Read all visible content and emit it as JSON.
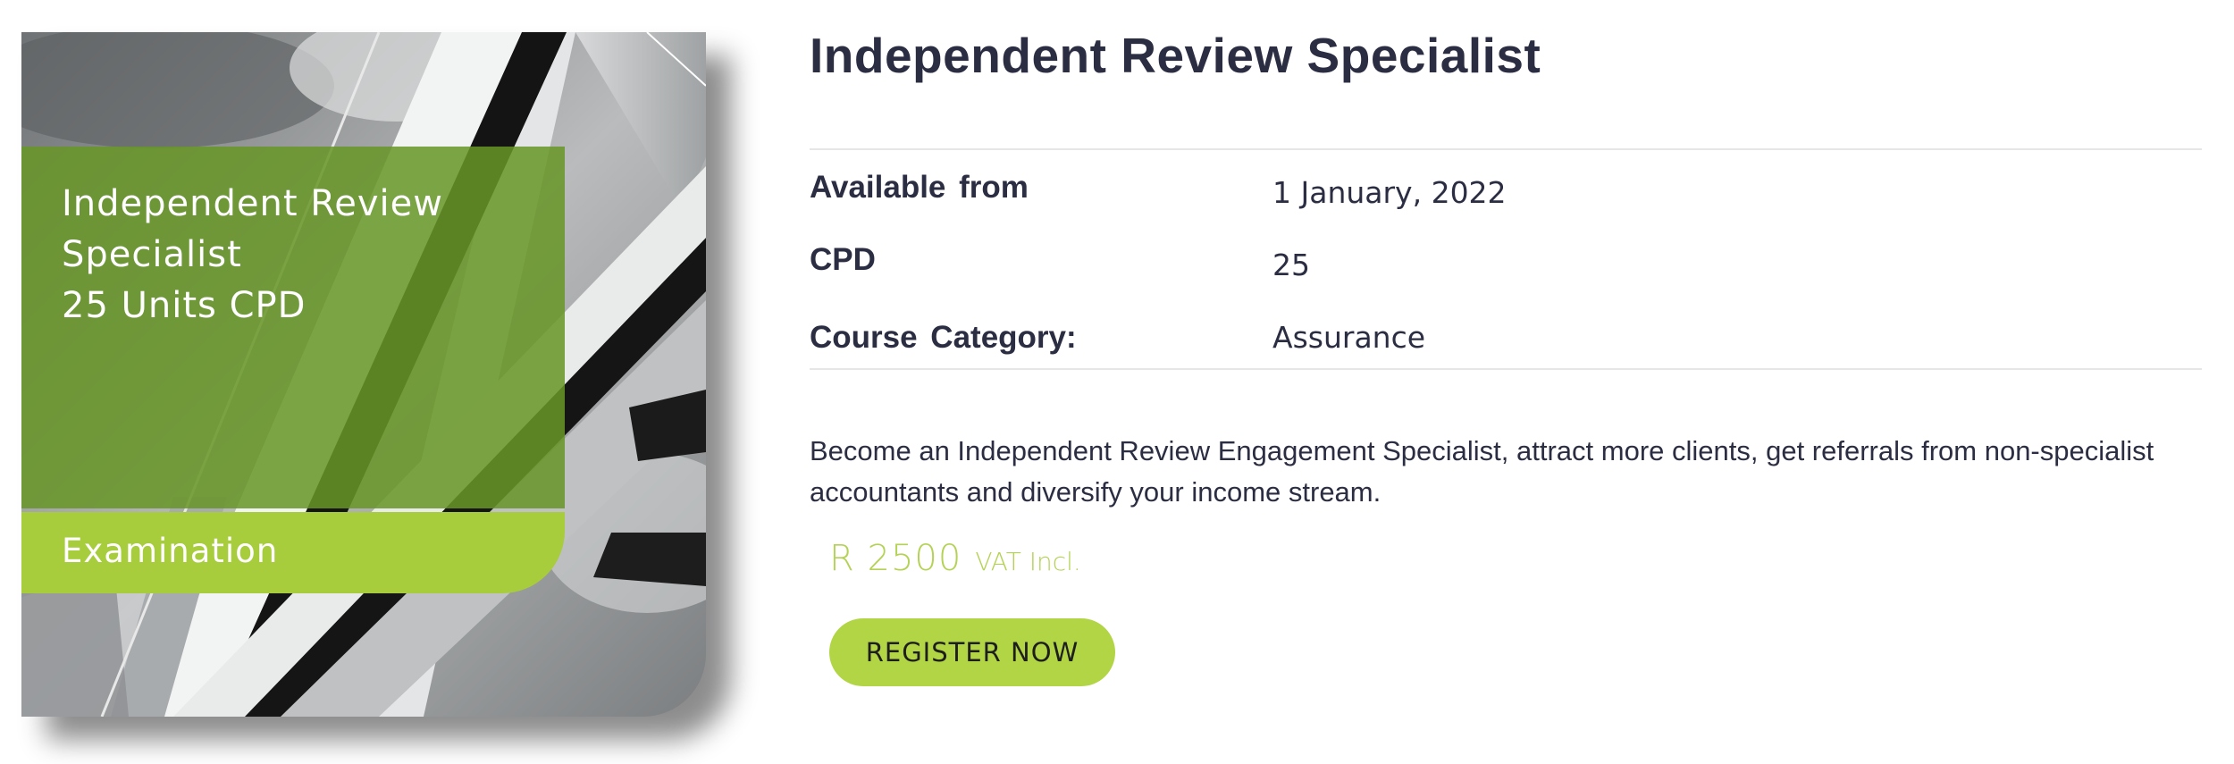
{
  "course_image": {
    "title_lines": [
      "Independent Review",
      "Specialist",
      "25 Units CPD"
    ],
    "band_label": "Examination"
  },
  "course": {
    "title": "Independent Review Specialist",
    "meta": [
      {
        "label": "Available from",
        "value": "1 January, 2022"
      },
      {
        "label": "CPD",
        "value": "25"
      },
      {
        "label": "Course Category:",
        "value": "Assurance"
      }
    ],
    "description": "Become an Independent Review Engagement Specialist, attract more clients, get referrals from non-specialist accountants and diversify your income stream.",
    "price": {
      "amount": "R 2500",
      "vat": "VAT Incl."
    },
    "register_label": "REGISTER NOW"
  },
  "colors": {
    "title_text": "#2b2d42",
    "panel_green": "#689628",
    "band_green": "#a7cc3c",
    "button_green": "#b1d544",
    "price_green": "#b4d255"
  }
}
